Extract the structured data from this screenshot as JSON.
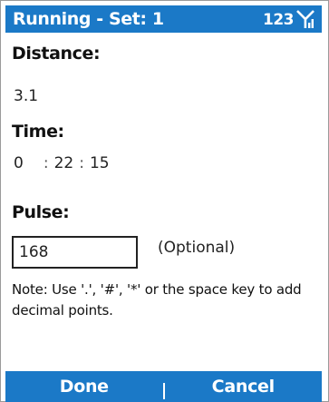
{
  "titlebar": {
    "title": "Running - Set: 1",
    "status_number": "123",
    "signal_icon": "signal-strength-icon"
  },
  "form": {
    "distance_label": "Distance:",
    "distance_value": "3.1",
    "time_label": "Time:",
    "time_hours": "0",
    "time_minutes": "22",
    "time_seconds": "15",
    "time_separator": ":",
    "pulse_label": "Pulse:",
    "pulse_value": "168",
    "pulse_hint": "(Optional)",
    "note": "Note: Use '.', '#', '*' or the space key to add decimal points."
  },
  "softkeys": {
    "left": "Done",
    "right": "Cancel"
  },
  "colors": {
    "accent": "#1b79c7",
    "text": "#111111",
    "background": "#ffffff"
  }
}
